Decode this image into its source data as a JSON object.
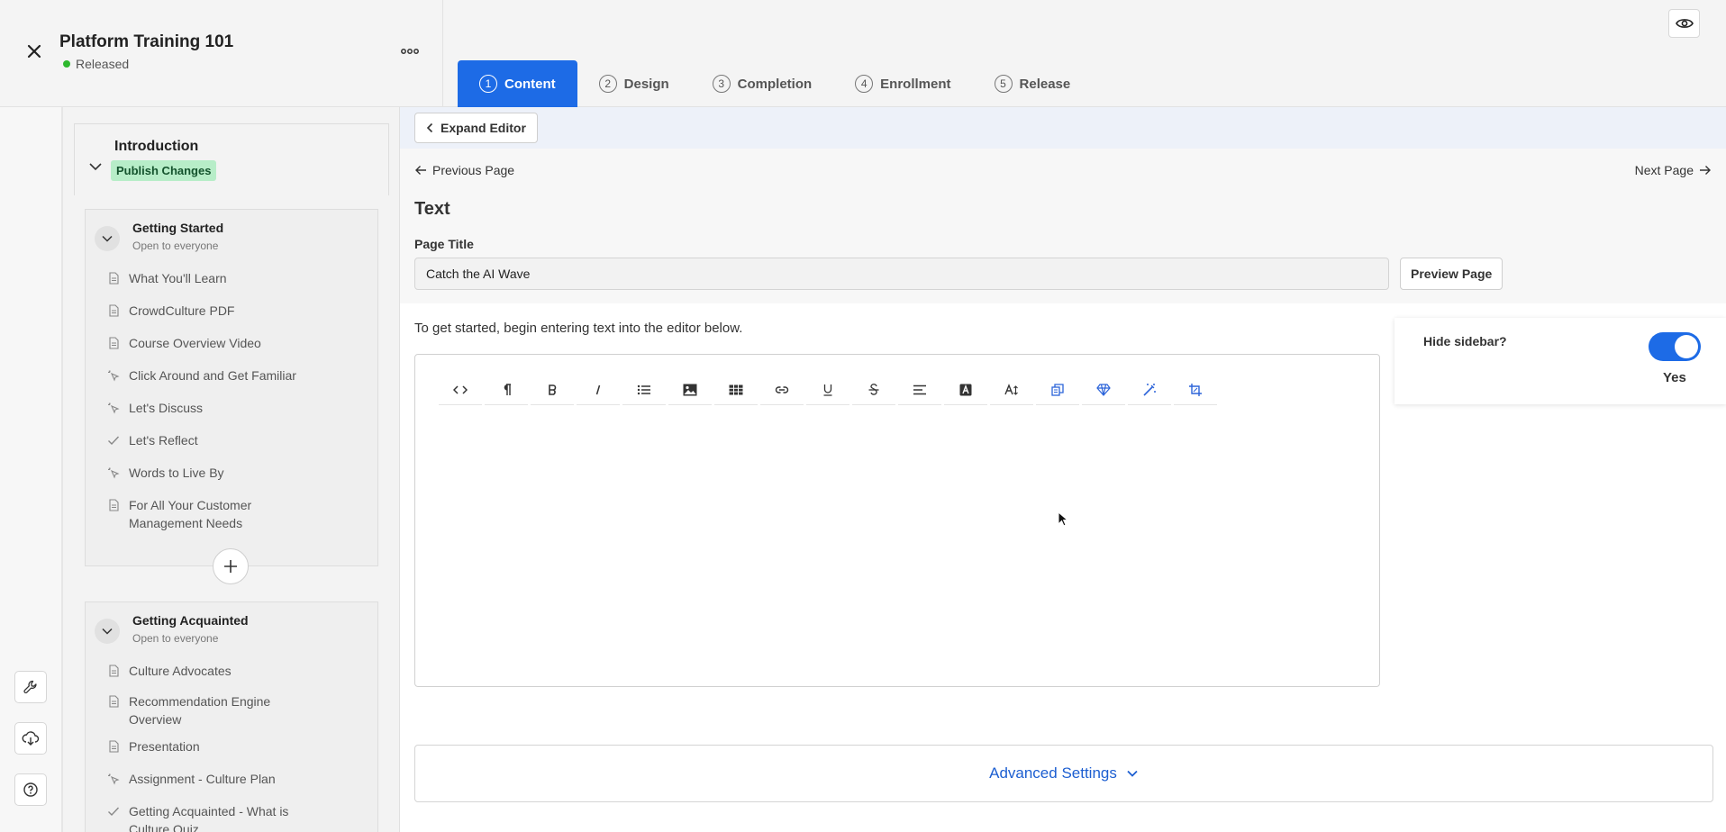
{
  "header": {
    "course_title": "Platform Training 101",
    "status": "Released",
    "status_color": "#2eb82e",
    "tabs": [
      {
        "num": "1",
        "label": "Content",
        "active": true
      },
      {
        "num": "2",
        "label": "Design",
        "active": false
      },
      {
        "num": "3",
        "label": "Completion",
        "active": false
      },
      {
        "num": "4",
        "label": "Enrollment",
        "active": false
      },
      {
        "num": "5",
        "label": "Release",
        "active": false
      }
    ],
    "accent_color": "#1d6be6"
  },
  "outline": {
    "intro": {
      "title": "Introduction",
      "badge": "Publish Changes"
    },
    "sections": [
      {
        "title": "Getting Started",
        "subtitle": "Open to everyone",
        "items": [
          {
            "label": "What You'll Learn",
            "icon": "document-icon"
          },
          {
            "label": "CrowdCulture PDF",
            "icon": "document-icon"
          },
          {
            "label": "Course Overview Video",
            "icon": "document-icon"
          },
          {
            "label": "Click Around and Get Familiar",
            "icon": "interactive-icon"
          },
          {
            "label": "Let's Discuss",
            "icon": "interactive-icon"
          },
          {
            "label": "Let's Reflect",
            "icon": "check-icon"
          },
          {
            "label": "Words to Live By",
            "icon": "interactive-icon"
          },
          {
            "label": "For All Your Customer Management Needs",
            "icon": "document-icon"
          }
        ]
      },
      {
        "title": "Getting Acquainted",
        "subtitle": "Open to everyone",
        "items": [
          {
            "label": "Culture Advocates",
            "icon": "document-icon"
          },
          {
            "label": "Recommendation Engine Overview",
            "icon": "document-icon"
          },
          {
            "label": "Presentation",
            "icon": "document-icon"
          },
          {
            "label": "Assignment - Culture Plan",
            "icon": "interactive-icon"
          },
          {
            "label": "Getting Acquainted - What is Culture Quiz",
            "icon": "check-icon"
          }
        ]
      }
    ]
  },
  "main": {
    "expand_label": "Expand Editor",
    "prev_label": "Previous Page",
    "next_label": "Next Page",
    "page_type": "Text",
    "page_title_label": "Page Title",
    "page_title_value": "Catch the AI Wave",
    "preview_label": "Preview Page",
    "instructions": "To get started, begin entering text into the editor below.",
    "toolbar": [
      "code-icon",
      "paragraph-icon",
      "bold-icon",
      "italic-icon",
      "list-icon",
      "image-icon",
      "table-icon",
      "link-icon",
      "underline-icon",
      "strikethrough-icon",
      "align-icon",
      "font-color-icon",
      "font-size-icon",
      "copy-icon",
      "gem-icon",
      "magic-wand-icon",
      "crop-icon"
    ],
    "sidebar_setting": {
      "label": "Hide sidebar?",
      "value": "Yes",
      "enabled": true
    },
    "advanced_label": "Advanced Settings"
  }
}
